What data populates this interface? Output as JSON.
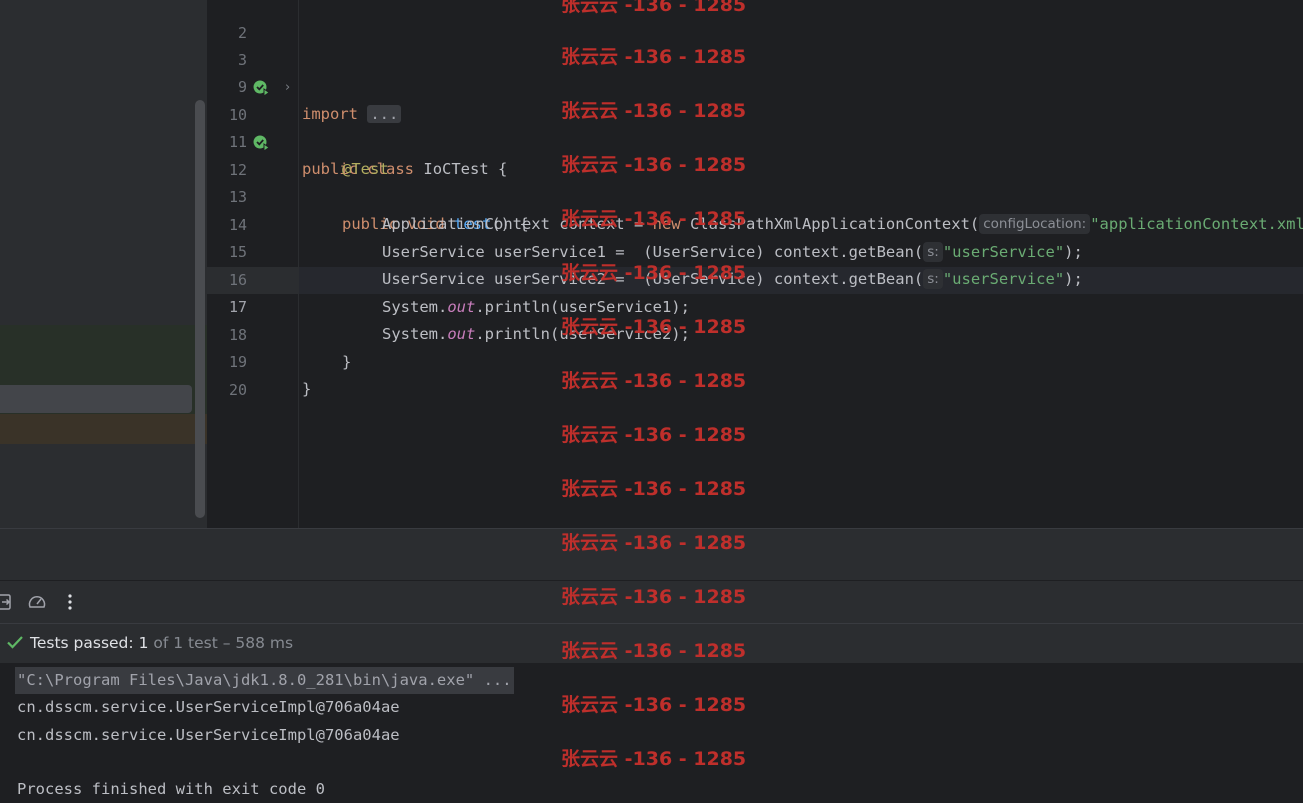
{
  "editor": {
    "lines": [
      {
        "num": "2"
      },
      {
        "num": "3",
        "kw": "import",
        "fold": "..."
      },
      {
        "num": "9"
      },
      {
        "num": "10",
        "kw1": "public",
        "kw2": "class",
        "rest": "IoCTest {"
      },
      {
        "num": "11",
        "ann": "@Test"
      },
      {
        "num": "12",
        "kw1": "public",
        "kw2": "void",
        "fn": "test",
        "rest": "() {"
      },
      {
        "num": "13",
        "pre": "ApplicationContext context = ",
        "kw": "new",
        "mid": " ClassPathXmlApplicationContext(",
        "hint": "configLocation:",
        "str": "\"applicationContext.xml\"",
        "post": ");"
      },
      {
        "num": "14",
        "pre": "UserService userService1 =  (UserService) context.getBean(",
        "hint": "s:",
        "str": "\"userService\"",
        "post": ");"
      },
      {
        "num": "15",
        "pre": "UserService userService2 =  (UserService) context.getBean(",
        "hint": "s:",
        "str": "\"userService\"",
        "post": ");"
      },
      {
        "num": "16",
        "pre": "System.",
        "field": "out",
        "post": ".println(userService1);"
      },
      {
        "num": "17",
        "pre": "System.",
        "field": "out",
        "post": ".println(userService2);"
      },
      {
        "num": "18",
        "rest": "}"
      },
      {
        "num": "19",
        "rest": "}"
      },
      {
        "num": "20"
      }
    ]
  },
  "run": {
    "status_label": "Tests passed:",
    "passed_count": "1",
    "meta": "of 1 test – 588 ms"
  },
  "console": {
    "cmd": "\"C:\\Program Files\\Java\\jdk1.8.0_281\\bin\\java.exe\" ...",
    "out1": "cn.dsscm.service.UserServiceImpl@706a04ae",
    "out2": "cn.dsscm.service.UserServiceImpl@706a04ae",
    "out3": "Process finished with exit code 0"
  },
  "watermark": "张云云 -136 - 1285",
  "colors": {
    "editor_bg": "#1e1f22",
    "panel_bg": "#2b2d30",
    "keyword": "#cf8e6d",
    "string": "#6aab73",
    "function": "#56a8f5",
    "annotation": "#b3ae60",
    "watermark": "#c7302c",
    "success": "#5fb865"
  },
  "icons": [
    "run-test-icon",
    "chevron-right-icon",
    "export-icon",
    "speedometer-icon",
    "more-vertical-icon",
    "check-icon"
  ]
}
